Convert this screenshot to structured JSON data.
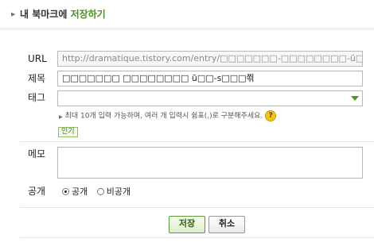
{
  "header": {
    "prefix": "내 북마크에 ",
    "accent": "저장하기"
  },
  "form": {
    "url": {
      "label": "URL",
      "value": "http://dramatique.tistory.com/entry/□□□□□□□-□□□□□□□□-ũ□□-s□□"
    },
    "title": {
      "label": "제목",
      "value": "□□□□□□□ □□□□□□□□ ũ□□-s□□□쬒"
    },
    "tags": {
      "label": "태그",
      "value": "",
      "hint": "최대 10개 입력 가능하며, 여러 개 입력시 쉼표(,)로 구분해주세요.",
      "help_icon": "?",
      "popular_label": "인기"
    },
    "memo": {
      "label": "메모",
      "value": ""
    },
    "visibility": {
      "label": "공개",
      "options": [
        {
          "label": "공개",
          "selected": true
        },
        {
          "label": "비공개",
          "selected": false
        }
      ]
    }
  },
  "buttons": {
    "save": "저장",
    "cancel": "취소"
  },
  "colors": {
    "accent": "#4a8e1c",
    "border": "#b8b8b8"
  }
}
